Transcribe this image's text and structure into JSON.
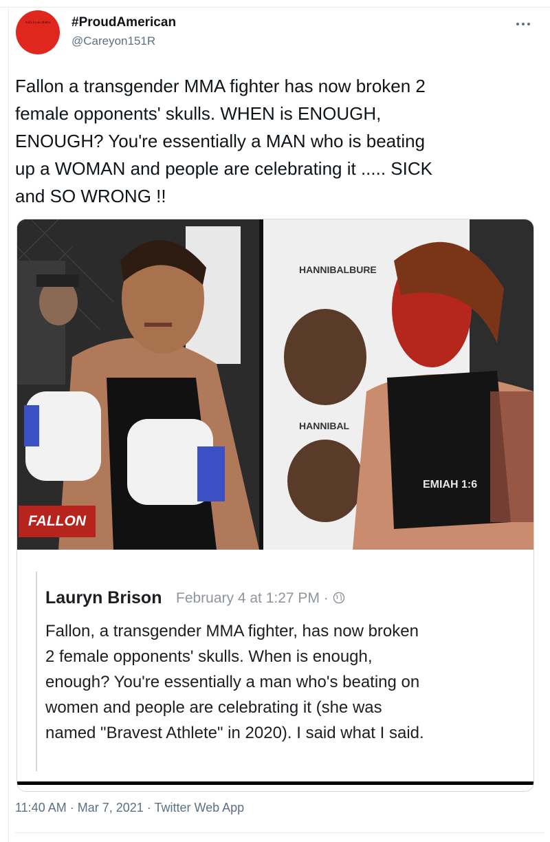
{
  "tweet": {
    "avatar_text": "AAS Lives Matter",
    "display_name": "#ProudAmerican",
    "handle": "@Careyon151R",
    "more_icon": "more-horizontal-icon",
    "text": "Fallon a transgender MMA fighter has now broken 2\nfemale opponents' skulls.  WHEN is ENOUGH,\nENOUGH?  You're essentially a MAN who is beating\nup a WOMAN and people are celebrating it .....  SICK\nand SO WRONG !!",
    "timestamp": "11:40 AM · Mar 7, 2021 · Twitter Web App"
  },
  "media": {
    "photo_label": "FALLON",
    "banner_text_top": "HANNIBALBURE",
    "banner_text_mid": "HANNIBAL",
    "shirt_text": "EMIAH 1:6",
    "quote": {
      "author": "Lauryn Brison",
      "date": "February 4 at 1:27 PM · ",
      "globe_icon": "globe-icon",
      "body": "Fallon, a transgender MMA fighter, has now broken\n2 female opponents' skulls. When is enough,\nenough? You're essentially a man who's beating on\nwomen and people are celebrating it (she was\nnamed \"Bravest Athlete\" in 2020). I said what I said."
    }
  },
  "colors": {
    "accent_red": "#b7231d",
    "muted": "#5b7083",
    "avatar_red": "#e0271d"
  }
}
